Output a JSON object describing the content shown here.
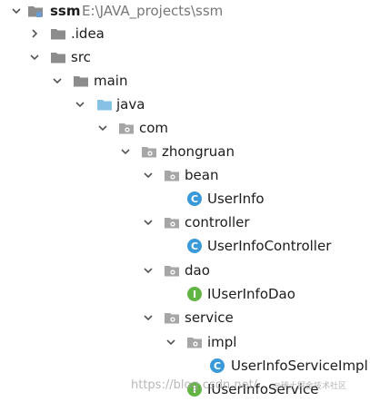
{
  "tree": {
    "root": {
      "label": "ssm",
      "path": "E:\\JAVA_projects\\ssm"
    },
    "idea": {
      "label": ".idea"
    },
    "src": {
      "label": "src"
    },
    "main": {
      "label": "main"
    },
    "java": {
      "label": "java"
    },
    "com": {
      "label": "com"
    },
    "zhongruan": {
      "label": "zhongruan"
    },
    "bean": {
      "label": "bean"
    },
    "userinfo": {
      "label": "UserInfo"
    },
    "controller": {
      "label": "controller"
    },
    "userinfocontroller": {
      "label": "UserInfoController"
    },
    "dao": {
      "label": "dao"
    },
    "iuserinfodao": {
      "label": "IUserInfoDao"
    },
    "service": {
      "label": "service"
    },
    "impl": {
      "label": "impl"
    },
    "userinfoserviceimpl": {
      "label": "UserInfoServiceImpl"
    },
    "iuserinfoservice": {
      "label": "IUserInfoService"
    }
  },
  "watermark": {
    "text": "https://blog.csdn.net/",
    "text2": "@稀土掘金技术社区"
  },
  "colors": {
    "folder_gray": "#8c8c8c",
    "folder_source_blue": "#87c1e4",
    "class_icon_blue": "#3a9ad9",
    "interface_icon_green": "#62b543",
    "text": "#1c1c1c",
    "path_text": "#777777"
  }
}
